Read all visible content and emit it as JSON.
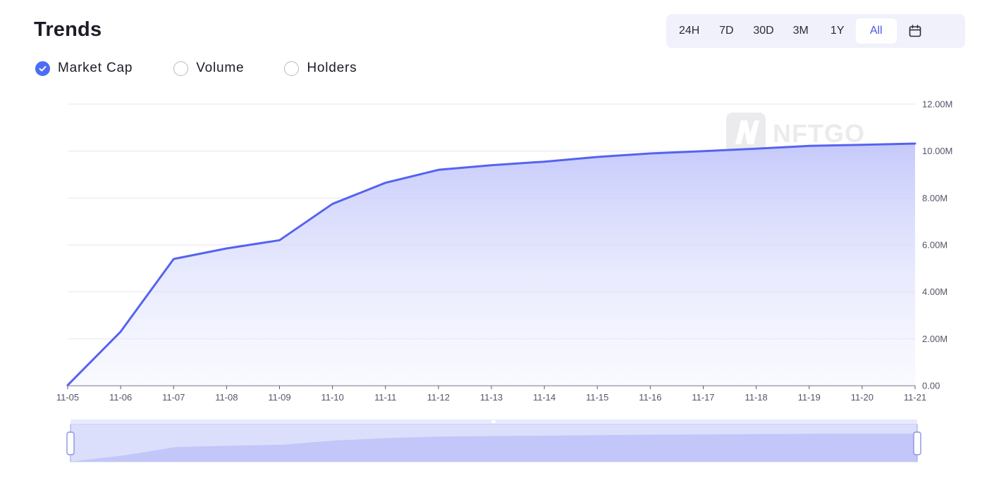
{
  "header": {
    "title": "Trends"
  },
  "range_selector": {
    "options": [
      "24H",
      "7D",
      "30D",
      "3M",
      "1Y",
      "All"
    ],
    "selected": "All",
    "calendar_icon": "calendar-icon"
  },
  "metrics": [
    {
      "label": "Market Cap",
      "checked": true
    },
    {
      "label": "Volume",
      "checked": false
    },
    {
      "label": "Holders",
      "checked": false
    }
  ],
  "watermark": "NFTGO",
  "colors": {
    "accent": "#5563f0",
    "area_fill": "#c9ccf9",
    "checked": "#4d6cf5"
  },
  "chart_data": {
    "type": "area",
    "x": [
      "11-05",
      "11-06",
      "11-07",
      "11-08",
      "11-09",
      "11-10",
      "11-11",
      "11-12",
      "11-13",
      "11-14",
      "11-15",
      "11-16",
      "11-17",
      "11-18",
      "11-19",
      "11-20",
      "11-21"
    ],
    "series": [
      {
        "values": [
          0.02,
          2.3,
          5.4,
          5.85,
          6.2,
          7.75,
          8.65,
          9.2,
          9.4,
          9.55,
          9.75,
          9.9,
          10.0,
          10.1,
          10.22,
          10.27,
          10.32
        ]
      }
    ],
    "y_ticks": [
      "0.00",
      "2.00M",
      "4.00M",
      "6.00M",
      "8.00M",
      "10.00M",
      "12.00M"
    ],
    "ylim": [
      0,
      12
    ],
    "y_unit": "M",
    "y_axis_side": "right",
    "grid": true,
    "has_range_slider": true
  }
}
